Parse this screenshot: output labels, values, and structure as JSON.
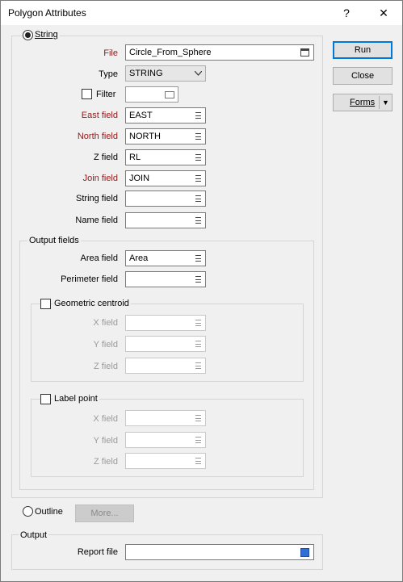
{
  "window": {
    "title": "Polygon Attributes",
    "help_label": "?",
    "close_label": "✕"
  },
  "string_radio": {
    "label": "String",
    "selected": true
  },
  "file": {
    "label": "File",
    "value": "Circle_From_Sphere"
  },
  "type": {
    "label": "Type",
    "value": "STRING"
  },
  "filter": {
    "label": "Filter",
    "checked": false,
    "value": ""
  },
  "fields": {
    "east": {
      "label": "East field",
      "value": "EAST"
    },
    "north": {
      "label": "North field",
      "value": "NORTH"
    },
    "z": {
      "label": "Z field",
      "value": "RL"
    },
    "join": {
      "label": "Join field",
      "value": "JOIN"
    },
    "string": {
      "label": "String field",
      "value": ""
    },
    "name": {
      "label": "Name field",
      "value": ""
    }
  },
  "output_fields": {
    "title": "Output fields",
    "area": {
      "label": "Area field",
      "value": "Area"
    },
    "perimeter": {
      "label": "Perimeter field",
      "value": ""
    },
    "centroid": {
      "label": "Geometric centroid",
      "checked": false,
      "x": {
        "label": "X field",
        "value": ""
      },
      "y": {
        "label": "Y field",
        "value": ""
      },
      "z": {
        "label": "Z field",
        "value": ""
      }
    },
    "label_point": {
      "label": "Label point",
      "checked": false,
      "x": {
        "label": "X field",
        "value": ""
      },
      "y": {
        "label": "Y field",
        "value": ""
      },
      "z": {
        "label": "Z field",
        "value": ""
      }
    }
  },
  "outline_radio": {
    "label": "Outline",
    "selected": false
  },
  "more_button": "More...",
  "output": {
    "title": "Output",
    "report_label": "Report file",
    "report_value": ""
  },
  "buttons": {
    "run": "Run",
    "close": "Close",
    "forms": "Forms",
    "forms_arrow": "▼"
  },
  "colors": {
    "required_label": "#8b1a1a",
    "default_button_border": "#0078d7",
    "browse_icon": "#2f6fd6"
  }
}
